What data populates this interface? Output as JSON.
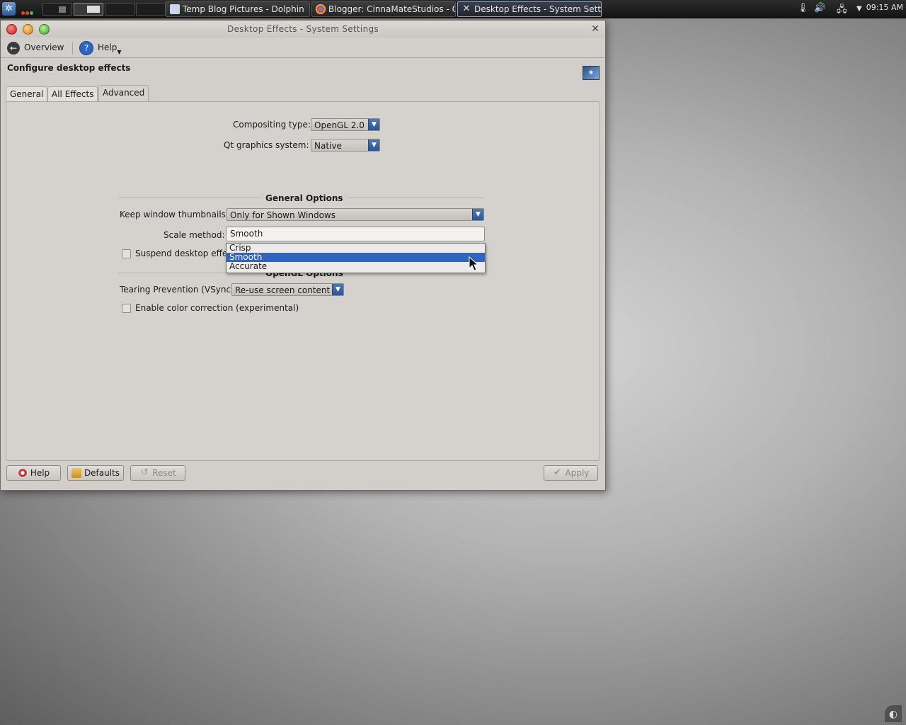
{
  "taskbar": {
    "tasks": [
      {
        "label": "Temp Blog Pictures - Dolphin"
      },
      {
        "label": "Blogger: CinnaMateStudios - C"
      },
      {
        "label": "Desktop Effects - System Sett"
      }
    ],
    "clock": "09:15 AM"
  },
  "window": {
    "title": "Desktop Effects - System Settings",
    "toolbar": {
      "overview_label": "Overview",
      "help_label": "Help"
    },
    "heading": "Configure desktop effects",
    "tabs": [
      {
        "label": "General"
      },
      {
        "label": "All Effects"
      },
      {
        "label": "Advanced",
        "active": true
      }
    ],
    "advanced": {
      "compositing_type": {
        "label": "Compositing type:",
        "value": "OpenGL 2.0"
      },
      "qt_graphics": {
        "label": "Qt graphics system:",
        "value": "Native"
      },
      "general_options_title": "General Options",
      "keep_thumbnails": {
        "label": "Keep window thumbnails:",
        "value": "Only for Shown Windows"
      },
      "scale_method": {
        "label": "Scale method:",
        "value": "Smooth",
        "options": [
          "Crisp",
          "Smooth",
          "Accurate"
        ],
        "highlighted": "Smooth"
      },
      "suspend_label": "Suspend desktop effe",
      "opengl_options_title": "OpenGL Options",
      "tearing": {
        "label": "Tearing Prevention (VSync)",
        "value": "Re-use screen content"
      },
      "color_correction_label": "Enable color correction (experimental)"
    },
    "buttons": {
      "help": "Help",
      "defaults": "Defaults",
      "reset": "Reset",
      "apply": "Apply"
    }
  },
  "colors": {
    "selection": "#2d66c2",
    "combo_arrow": "#3d67a6",
    "close_button": "#e0403a",
    "minimize_button": "#e8a23a",
    "maximize_button": "#6cc04a"
  }
}
